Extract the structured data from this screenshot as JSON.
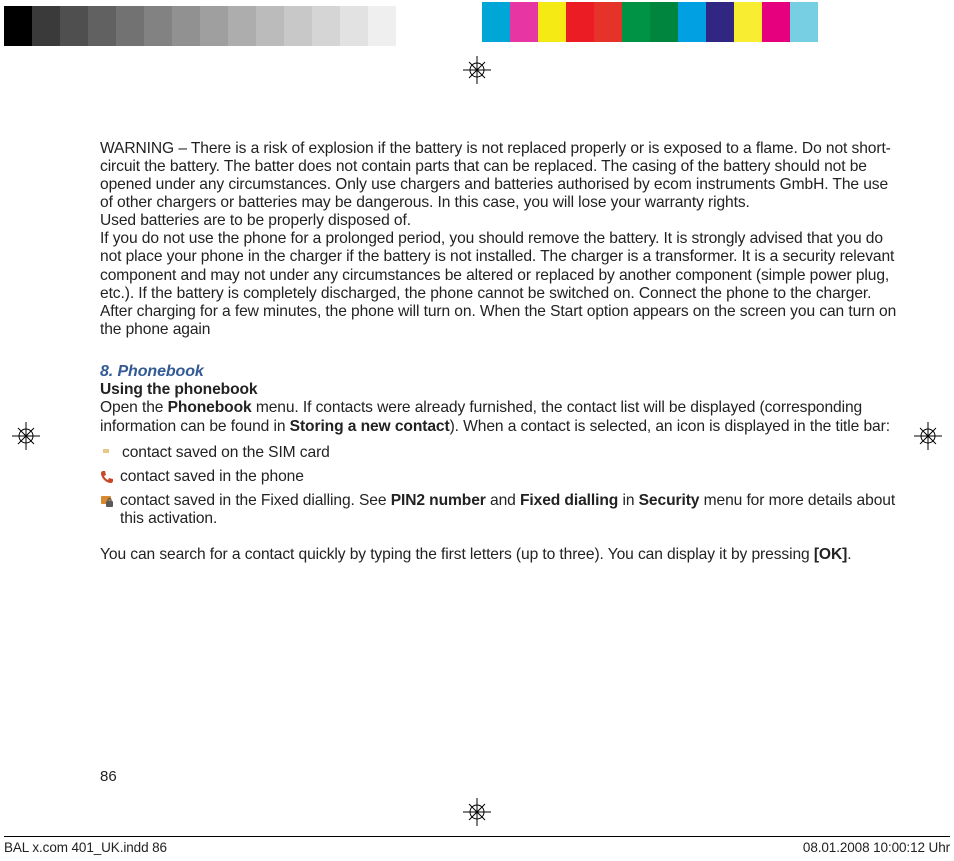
{
  "warning_para": "WARNING – There is a risk of explosion if the battery is not replaced properly or is exposed to a flame. Do not short-circuit the battery. The batter does not contain parts that can be replaced. The casing of the battery should not be opened under any circumstances. Only use chargers and batteries authorised by ecom instruments GmbH. The use of other chargers or batteries may be dangerous. In this case, you will lose your warranty rights.",
  "used_batt": "Used batteries are to be properly disposed of.",
  "prolonged": "If you do not use the phone for a prolonged period, you should remove the battery. It is strongly advised that you do not place your phone in the charger if the battery is not installed. The charger is a transformer. It is a security relevant component and may not under any circumstances be altered or replaced by another component (simple power plug, etc.). If the battery is completely discharged, the phone cannot be switched on. Connect the phone to the charger. After charging for a few minutes, the phone will turn on. When the Start option appears on the screen you can turn on the phone again",
  "section_title": "8. Phonebook",
  "subhead": "Using the phonebook",
  "open_pre": "Open the ",
  "open_bold1": "Phonebook",
  "open_mid": " menu. If contacts were already furnished, the contact list will be displayed (corresponding information can be found in ",
  "open_bold2": "Storing a new contact",
  "open_post": "). When a contact is selected, an icon is displayed in the title bar:",
  "sim_line": "contact saved on the SIM card",
  "phone_line": "contact saved in the phone",
  "fixed_pre": "contact saved in the Fixed dialling. See ",
  "fixed_b1": "PIN2 number",
  "fixed_mid1": " and ",
  "fixed_b2": "Fixed dialling",
  "fixed_mid2": " in ",
  "fixed_b3": "Security",
  "fixed_post": " menu for  more details about this activation.",
  "search_pre": "You can search for a contact quickly by typing the first letters (up to three). You can display it by pressing ",
  "search_b": "[OK]",
  "search_post": ".",
  "page_num": "86",
  "footer_left": "BAL x.com 401_UK.indd   86",
  "footer_right": "08.01.2008   10:00:12 Uhr",
  "grays": [
    "#000000",
    "#3a3a3a",
    "#4f4f4f",
    "#616161",
    "#727272",
    "#828282",
    "#919191",
    "#9f9f9f",
    "#adadad",
    "#bbbbbb",
    "#c8c8c8",
    "#d5d5d5",
    "#e2e2e2",
    "#efefef",
    "#ffffff"
  ],
  "colors": [
    "#00a6d6",
    "#e735a3",
    "#f6ea14",
    "#ec1c24",
    "#e6332a",
    "#009245",
    "#00853e",
    "#00a0e3",
    "#312783",
    "#f9ed32",
    "#e6007e",
    "#76cfe3"
  ]
}
